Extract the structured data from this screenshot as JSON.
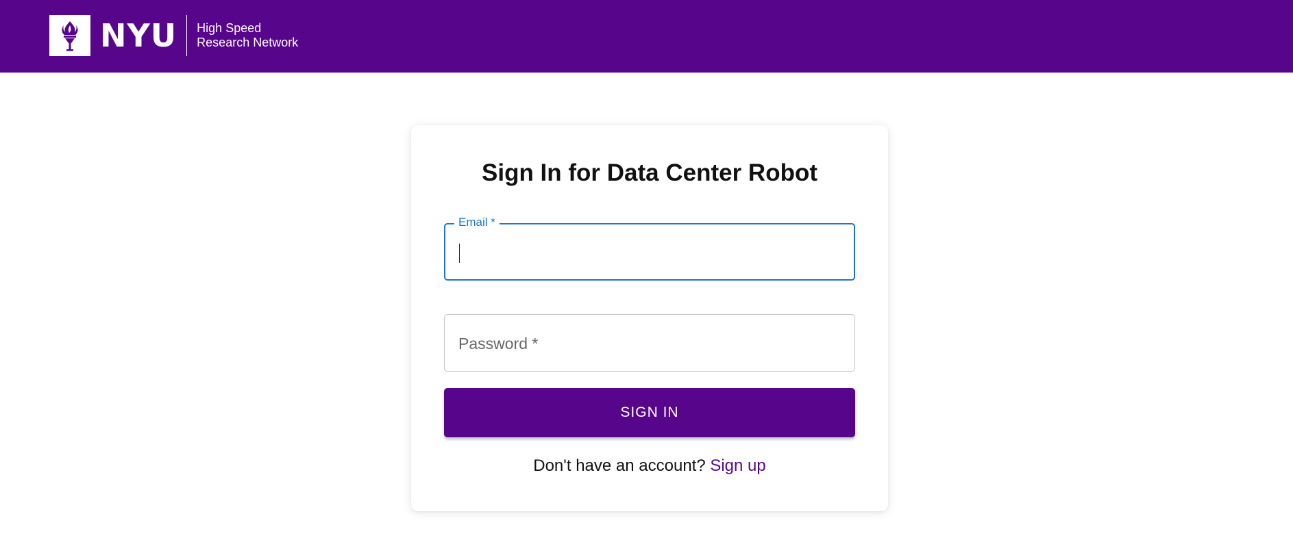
{
  "header": {
    "brand_name": "NYU",
    "subtitle_line1": "High Speed",
    "subtitle_line2": "Research Network",
    "logo_icon": "torch-icon",
    "background_color": "#57068c"
  },
  "form": {
    "title": "Sign In for Data Center Robot",
    "email_label": "Email *",
    "email_value": "",
    "password_label": "Password *",
    "password_value": "",
    "submit_label": "SIGN IN",
    "signup_prompt": "Don't have an account?",
    "signup_link": "Sign up"
  },
  "colors": {
    "accent": "#57068c",
    "focus": "#1976d2"
  }
}
